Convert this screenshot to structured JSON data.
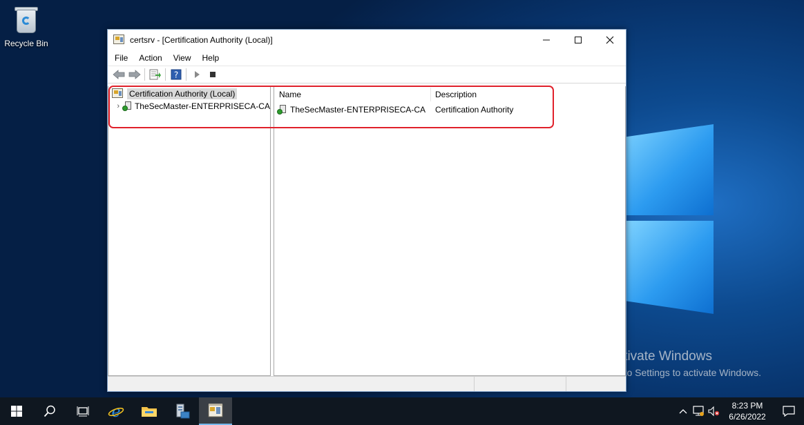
{
  "desktop": {
    "recycle_bin_label": "Recycle Bin",
    "watermark_title": "Activate Windows",
    "watermark_sub": "Go to Settings to activate Windows."
  },
  "window": {
    "title": "certsrv - [Certification Authority (Local)]",
    "menu": [
      "File",
      "Action",
      "View",
      "Help"
    ],
    "tree": {
      "root_label": "Certification Authority (Local)",
      "child_label": "TheSecMaster-ENTERPRISECA-CA"
    },
    "list": {
      "columns": [
        "Name",
        "Description"
      ],
      "rows": [
        {
          "name": "TheSecMaster-ENTERPRISECA-CA",
          "description": "Certification Authority"
        }
      ]
    }
  },
  "taskbar": {
    "time": "8:23 PM",
    "date": "6/26/2022",
    "items": [
      "start-icon",
      "search-icon",
      "task-view-icon",
      "internet-explorer-icon",
      "file-explorer-icon",
      "server-manager-icon",
      "certsrv-icon"
    ]
  },
  "colors": {
    "highlight": "#e0202a",
    "taskbar": "#0f1720",
    "accent": "#76b9ed"
  }
}
